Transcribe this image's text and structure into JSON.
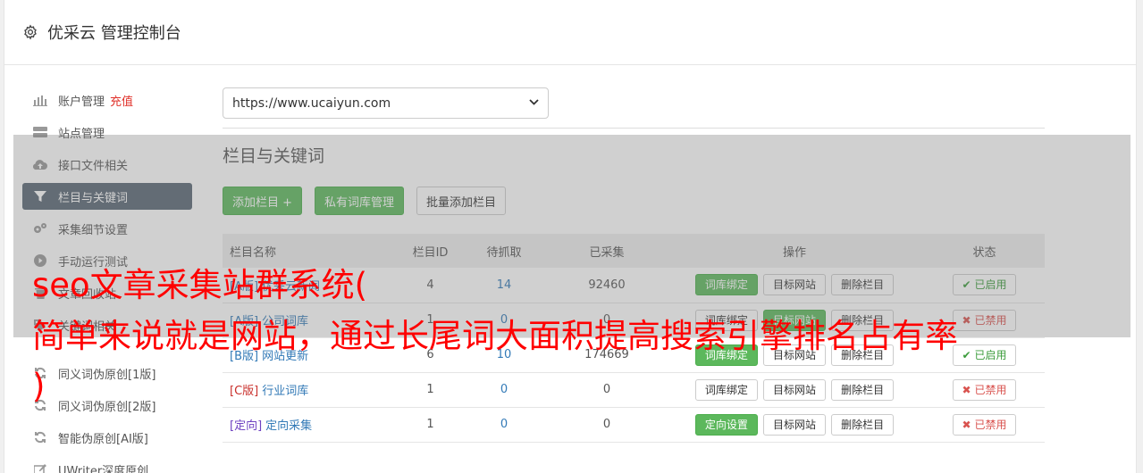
{
  "header": {
    "title": "优采云 管理控制台",
    "icon": "gear-icon"
  },
  "sidebar": {
    "items": [
      {
        "label": "账户管理",
        "badge": "充值",
        "icon": "bar-chart-icon"
      },
      {
        "label": "站点管理",
        "icon": "server-icon"
      },
      {
        "label": "接口文件相关",
        "icon": "cloud-upload-icon"
      },
      {
        "label": "栏目与关键词",
        "icon": "filter-icon",
        "active": true
      },
      {
        "label": "采集细节设置",
        "icon": "cogs-icon"
      },
      {
        "label": "手动运行测试",
        "icon": "play-icon"
      },
      {
        "label": "文章回收站",
        "icon": "trash-icon"
      },
      {
        "label": "关键词相关",
        "icon": "tag-icon"
      },
      {
        "label": "同义词伪原创[1版]",
        "icon": "refresh-icon"
      },
      {
        "label": "同义词伪原创[2版]",
        "icon": "refresh-icon"
      },
      {
        "label": "智能伪原创[AI版]",
        "icon": "refresh-icon"
      },
      {
        "label": "UWriter深度原创",
        "icon": "edit-icon"
      }
    ]
  },
  "main": {
    "site_select_value": "https://www.ucaiyun.com",
    "section_title": "栏目与关键词",
    "buttons": {
      "add": "添加栏目 +",
      "private_lib": "私有词库管理",
      "batch_add": "批量添加栏目"
    },
    "table": {
      "headers": [
        "栏目名称",
        "栏目ID",
        "待抓取",
        "已采集",
        "操作",
        "状态"
      ],
      "rows": [
        {
          "tag": "[A版]",
          "name": "优采云新闻",
          "id": "4",
          "pending": "14",
          "collected": "92460",
          "op1": "词库绑定",
          "op2": "目标网站",
          "op3": "删除栏目",
          "status": "已启用",
          "enabled": true
        },
        {
          "tag": "[A版]",
          "name": "公司词库",
          "id": "1",
          "pending": "0",
          "collected": "0",
          "op1": "词库绑定",
          "op2": "目标网站",
          "op3": "删除栏目",
          "status": "已禁用",
          "enabled": false
        },
        {
          "tag": "[B版]",
          "name": "网站更新",
          "id": "6",
          "pending": "10",
          "collected": "174669",
          "op1": "词库绑定",
          "op2": "目标网站",
          "op3": "删除栏目",
          "status": "已启用",
          "enabled": true
        },
        {
          "tag": "[C版]",
          "name": "行业词库",
          "id": "1",
          "pending": "0",
          "collected": "0",
          "op1": "词库绑定",
          "op2": "目标网站",
          "op3": "删除栏目",
          "status": "已禁用",
          "enabled": false
        },
        {
          "tag": "[定向]",
          "name": "定向采集",
          "id": "1",
          "pending": "0",
          "collected": "0",
          "op1": "定向设置",
          "op2": "目标网站",
          "op3": "删除栏目",
          "status": "已禁用",
          "enabled": false
        }
      ]
    }
  },
  "overlay_text": {
    "line1": "seo文章采集站群系统(",
    "line2": "简单来说就是网站，通过长尾词大面积提高搜索引擎排名占有率",
    "line3": ")"
  },
  "colors": {
    "primary_green": "#5cb85c",
    "active_sidebar": "#586674",
    "link_blue": "#337ab7",
    "danger_red": "#d9534f",
    "overlay_red": "#ff0000"
  }
}
